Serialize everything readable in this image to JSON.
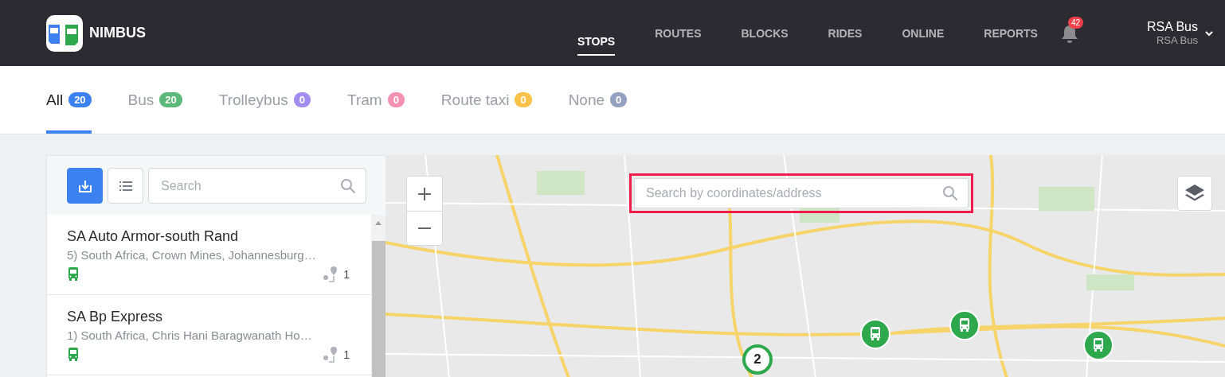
{
  "header": {
    "logo": "NIMBUS",
    "nav": [
      {
        "label": "STOPS",
        "selected": true
      },
      {
        "label": "ROUTES",
        "selected": false
      },
      {
        "label": "BLOCKS",
        "selected": false
      },
      {
        "label": "RIDES",
        "selected": false
      },
      {
        "label": "ONLINE",
        "selected": false
      },
      {
        "label": "REPORTS",
        "selected": false
      }
    ],
    "notifications": "42",
    "user": {
      "name": "RSA Bus",
      "account": "RSA Bus"
    }
  },
  "tabs": [
    {
      "label": "All",
      "count": "20",
      "color": "#3b82f0",
      "selected": true
    },
    {
      "label": "Bus",
      "count": "20",
      "color": "#5cb97a",
      "selected": false
    },
    {
      "label": "Trolleybus",
      "count": "0",
      "color": "#a38cf0",
      "selected": false
    },
    {
      "label": "Tram",
      "count": "0",
      "color": "#f291b0",
      "selected": false
    },
    {
      "label": "Route taxi",
      "count": "0",
      "color": "#fbc24a",
      "selected": false
    },
    {
      "label": "None",
      "count": "0",
      "color": "#94a0c0",
      "selected": false
    }
  ],
  "list": {
    "search": {
      "placeholder": "Search"
    },
    "stops": [
      {
        "name": "SA Auto Armor-south Rand",
        "address": "5) South Africa, Crown Mines, Johannesburg…",
        "routes": "1"
      },
      {
        "name": "SA Bp Express",
        "address": "1) South Africa, Chris Hani Baragwanath Ho…",
        "routes": "1"
      }
    ]
  },
  "map": {
    "search": {
      "placeholder": "Search by coordinates/address"
    },
    "markers": [
      {
        "kind": "cluster",
        "count": "2"
      },
      {
        "kind": "bus"
      },
      {
        "kind": "bus"
      },
      {
        "kind": "bus"
      }
    ]
  }
}
